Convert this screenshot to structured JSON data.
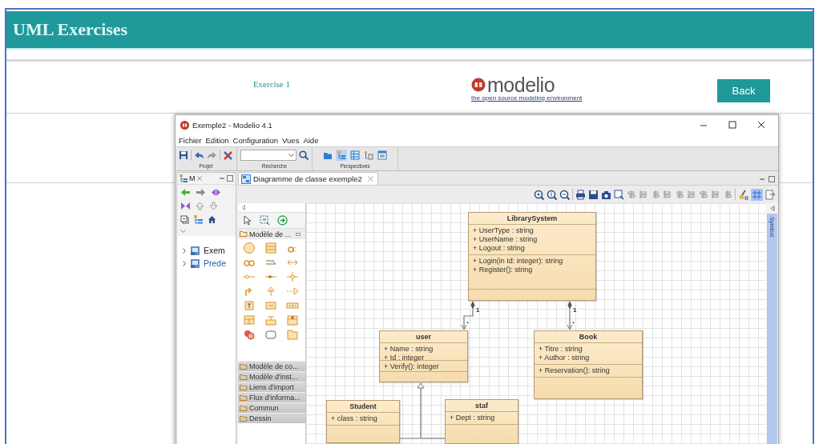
{
  "page": {
    "title": "UML Exercises",
    "exercise_link": "Exercise 1",
    "logo": {
      "name": "modelio",
      "tagline": "the open source modeling environment"
    },
    "back_button": "Back"
  },
  "window": {
    "title": "Exemple2 - Modelio 4.1",
    "menu": [
      "Fichier",
      "Edition",
      "Configuration",
      "Vues",
      "Aide"
    ],
    "toolbar": {
      "groups": [
        "Projet",
        "Recherche",
        "Perspectives"
      ],
      "perspectives": [
        {
          "selected": false
        },
        {
          "selected": true
        },
        {
          "selected": false
        },
        {
          "selected": false
        },
        {
          "selected": false
        }
      ]
    },
    "model_panel": {
      "tab": "M",
      "tree": [
        {
          "label": "Exem",
          "expanded": false,
          "color": "#222222"
        },
        {
          "label": "Prede",
          "expanded": false,
          "color": "#2b5fb3"
        }
      ]
    },
    "editor": {
      "tab": "Diagramme de classe exemple2",
      "grid": {
        "on": true
      },
      "side_tab": "Symbol",
      "palette": {
        "open_category": "Modèle de ...",
        "categories": [
          "Modèle de co...",
          "Modèle d'inst...",
          "Liens d'import",
          "Flux d'informa...",
          "Commun",
          "Dessin"
        ]
      },
      "diagram": {
        "classes": [
          {
            "name": "LibrarySystem",
            "attributes": [
              "+ UserType : string",
              "+ UserName : string",
              "+ Logout : string"
            ],
            "operations": [
              "+ Login(in Id: integer): string",
              "+ Register(): string"
            ]
          },
          {
            "name": "user",
            "attributes": [
              "+ Name : string",
              "+ Id : integer"
            ],
            "operations": [
              "+ Verify(): integer"
            ]
          },
          {
            "name": "Book",
            "attributes": [
              "+ Titre : string",
              "+ Author : string"
            ],
            "operations": [
              "+ Reservation(): string"
            ]
          },
          {
            "name": "Student",
            "attributes": [
              "+ class : string"
            ]
          },
          {
            "name": "staf",
            "attributes": [
              "+ Dept : string"
            ]
          }
        ],
        "relations": [
          {
            "kind": "composition",
            "source_multiplicity": "1",
            "target_multiplicity": "*"
          },
          {
            "kind": "composition",
            "source_multiplicity": "1",
            "target_multiplicity": "*"
          },
          {
            "kind": "generalization"
          },
          {
            "kind": "generalization"
          }
        ]
      }
    }
  }
}
